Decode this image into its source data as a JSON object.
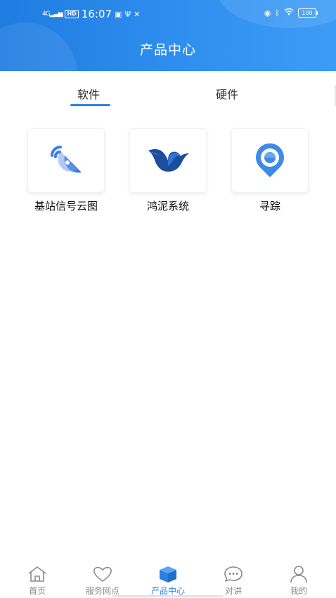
{
  "status_bar": {
    "network": "4G",
    "hd": "HD",
    "time": "16:07",
    "battery": "100"
  },
  "header": {
    "title": "产品中心"
  },
  "tabs": [
    {
      "label": "软件",
      "active": true
    },
    {
      "label": "硬件",
      "active": false
    }
  ],
  "products": [
    {
      "label": "基站信号云图",
      "icon": "satellite-dish-icon"
    },
    {
      "label": "鸿泥系统",
      "icon": "bird-logo-icon"
    },
    {
      "label": "寻踪",
      "icon": "location-pin-icon"
    }
  ],
  "bottom_nav": [
    {
      "label": "首页",
      "icon": "home-icon",
      "active": false
    },
    {
      "label": "服务网点",
      "icon": "heart-icon",
      "active": false
    },
    {
      "label": "产品中心",
      "icon": "cube-icon",
      "active": true
    },
    {
      "label": "对讲",
      "icon": "chat-bubble-icon",
      "active": false
    },
    {
      "label": "我的",
      "icon": "user-icon",
      "active": false
    }
  ],
  "colors": {
    "header_blue": "#1f7ce0",
    "accent": "#2a82e4",
    "inactive_text": "#8a8a8a"
  }
}
